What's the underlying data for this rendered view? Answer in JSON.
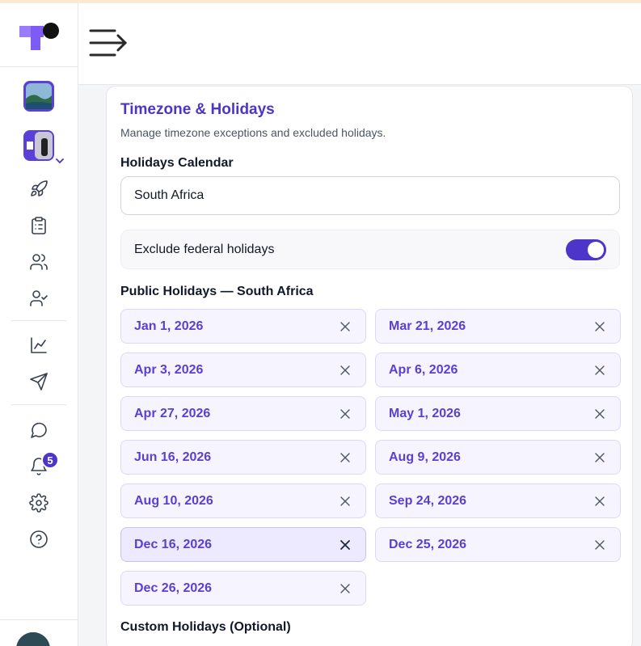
{
  "sidebar": {
    "notifications_count": "5",
    "nav_icons": [
      "rocket-icon",
      "clipboard-list-icon",
      "users-icon",
      "user-check-icon",
      "chart-line-icon",
      "send-icon",
      "chat-icon",
      "bell-icon",
      "gear-icon",
      "help-circle-icon"
    ]
  },
  "card": {
    "title": "Timezone & Holidays",
    "subtitle": "Manage timezone exceptions and excluded holidays.",
    "holidays_calendar_label": "Holidays Calendar",
    "holidays_calendar_value": "South Africa",
    "exclude_label": "Exclude federal holidays",
    "exclude_enabled": true,
    "public_holidays_label": "Public Holidays — South Africa",
    "holidays": [
      "Jan 1, 2026",
      "Mar 21, 2026",
      "Apr 3, 2026",
      "Apr 6, 2026",
      "Apr 27, 2026",
      "May 1, 2026",
      "Jun 16, 2026",
      "Aug 9, 2026",
      "Aug 10, 2026",
      "Sep 24, 2026",
      "Dec 16, 2026",
      "Dec 25, 2026",
      "Dec 26, 2026"
    ],
    "active_holiday": "Dec 16, 2026",
    "custom_holidays_label": "Custom Holidays (Optional)"
  },
  "colors": {
    "accent": "#4c35c8",
    "chip_bg": "#f6f4ff",
    "chip_text": "#5b3fd0"
  }
}
